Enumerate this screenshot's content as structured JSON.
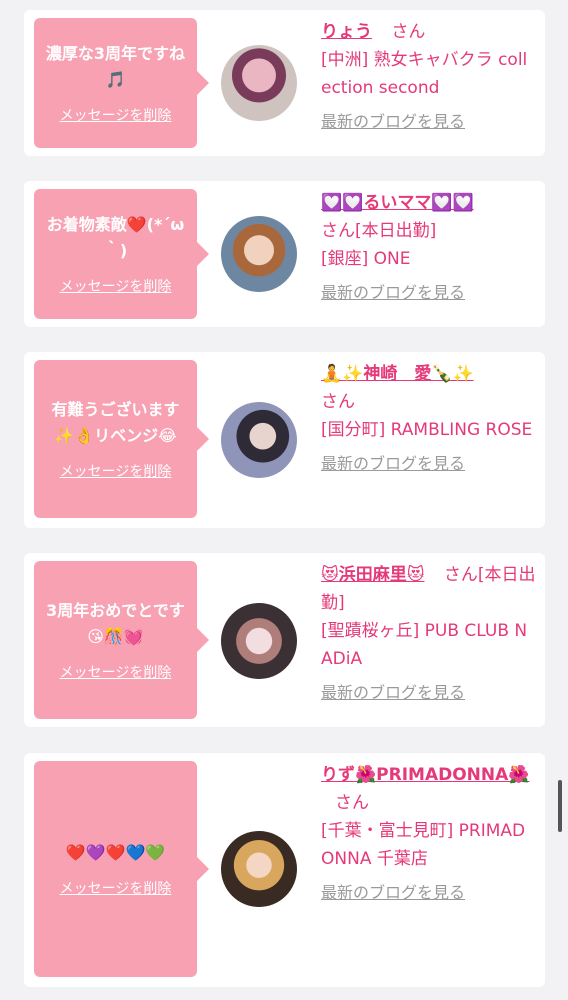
{
  "colors": {
    "bubble": "#f8a1b3",
    "accent": "#e5397a",
    "muted": "#9a9a9a",
    "background": "#f2f2f4"
  },
  "delete_label": "メッセージを削除",
  "blog_label": "最新のブログを見る",
  "san_label": "さん",
  "cards": [
    {
      "message": "濃厚な3周年ですね🎵",
      "name": "りょう",
      "suffix": "さん",
      "shop": "[中洲] 熟女キャバクラ collection second"
    },
    {
      "message": "お着物素敵❤️(*´ω｀)",
      "name": "💟💟るいママ💟💟",
      "suffix": "さん[本日出勤]",
      "shop": "[銀座] ONE"
    },
    {
      "message": "有難うございます✨👌リベンジ😂",
      "name": "🧘✨神崎　愛🍾✨",
      "suffix": "さん",
      "shop": "[国分町] RAMBLING ROSE"
    },
    {
      "message": "3周年おめでとです😘🎊💓",
      "name": "😻浜田麻里😻",
      "suffix": "さん[本日出勤]",
      "shop": "[聖蹟桜ヶ丘] PUB CLUB NADiA"
    },
    {
      "message": "❤️💜❤️💙💚",
      "name": "りず🌺PRIMADONNA🌺",
      "suffix": "さん",
      "shop": "[千葉・富士見町] PRIMADONNA 千葉店"
    }
  ]
}
